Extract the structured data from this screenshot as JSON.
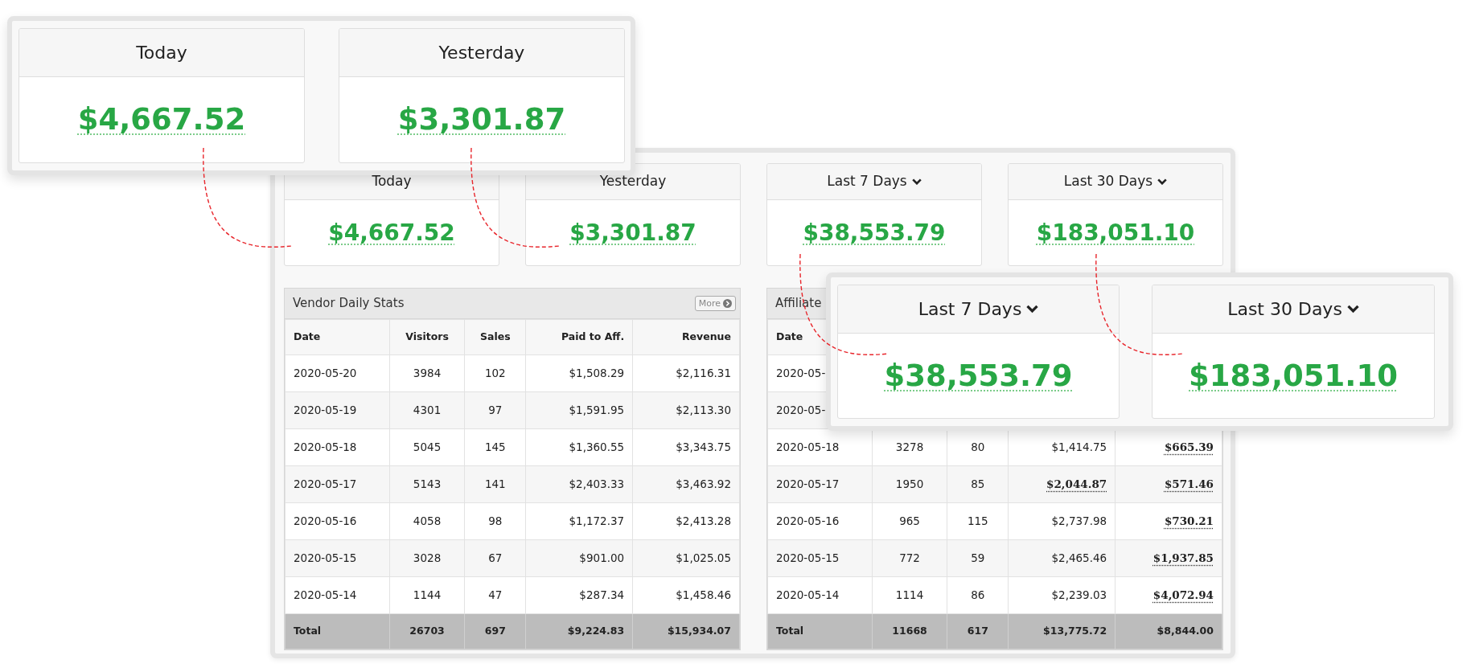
{
  "summary_cards": [
    {
      "title": "Today",
      "value": "$4,667.52",
      "dropdown": false
    },
    {
      "title": "Yesterday",
      "value": "$3,301.87",
      "dropdown": false
    },
    {
      "title": "Last 7 Days",
      "value": "$38,553.79",
      "dropdown": true
    },
    {
      "title": "Last 30 Days",
      "value": "$183,051.10",
      "dropdown": true
    }
  ],
  "tables": [
    {
      "title": "Vendor Daily Stats",
      "more_button": "More",
      "columns": [
        "Date",
        "Visitors",
        "Sales",
        "Paid to Aff.",
        "Revenue"
      ],
      "rows": [
        [
          "2020-05-20",
          "3984",
          "102",
          "$1,508.29",
          "$2,116.31"
        ],
        [
          "2020-05-19",
          "4301",
          "97",
          "$1,591.95",
          "$2,113.30"
        ],
        [
          "2020-05-18",
          "5045",
          "145",
          "$1,360.55",
          "$3,343.75"
        ],
        [
          "2020-05-17",
          "5143",
          "141",
          "$2,403.33",
          "$3,463.92"
        ],
        [
          "2020-05-16",
          "4058",
          "98",
          "$1,172.37",
          "$2,413.28"
        ],
        [
          "2020-05-15",
          "3028",
          "67",
          "$901.00",
          "$1,025.05"
        ],
        [
          "2020-05-14",
          "1144",
          "47",
          "$287.34",
          "$1,458.46"
        ]
      ],
      "total": [
        "Total",
        "26703",
        "697",
        "$9,224.83",
        "$15,934.07"
      ]
    },
    {
      "title": "Affiliate",
      "columns": [
        "Date"
      ],
      "rows": [
        [
          "2020-05-"
        ],
        [
          "2020-05-"
        ],
        [
          "2020-05-18",
          "3278",
          "80",
          "$1,414.75",
          {
            "text": "$665.39",
            "underlined": true
          }
        ],
        [
          "2020-05-17",
          "1950",
          "85",
          {
            "text": "$2,044.87",
            "underlined": true
          },
          {
            "text": "$571.46",
            "underlined": true
          }
        ],
        [
          "2020-05-16",
          "965",
          "115",
          "$2,737.98",
          {
            "text": "$730.21",
            "underlined": true
          }
        ],
        [
          "2020-05-15",
          "772",
          "59",
          "$2,465.46",
          {
            "text": "$1,937.85",
            "underlined": true
          }
        ],
        [
          "2020-05-14",
          "1114",
          "86",
          "$2,239.03",
          {
            "text": "$4,072.94",
            "underlined": true
          }
        ]
      ],
      "total": [
        "Total",
        "11668",
        "617",
        "$13,775.72",
        "$8,844.00"
      ]
    }
  ],
  "callouts": [
    {
      "cards": [
        {
          "title": "Today",
          "value": "$4,667.52",
          "dropdown": false
        },
        {
          "title": "Yesterday",
          "value": "$3,301.87",
          "dropdown": false
        }
      ]
    },
    {
      "cards": [
        {
          "title": "Last 7 Days",
          "value": "$38,553.79",
          "dropdown": true
        },
        {
          "title": "Last 30 Days",
          "value": "$183,051.10",
          "dropdown": true
        }
      ]
    }
  ]
}
